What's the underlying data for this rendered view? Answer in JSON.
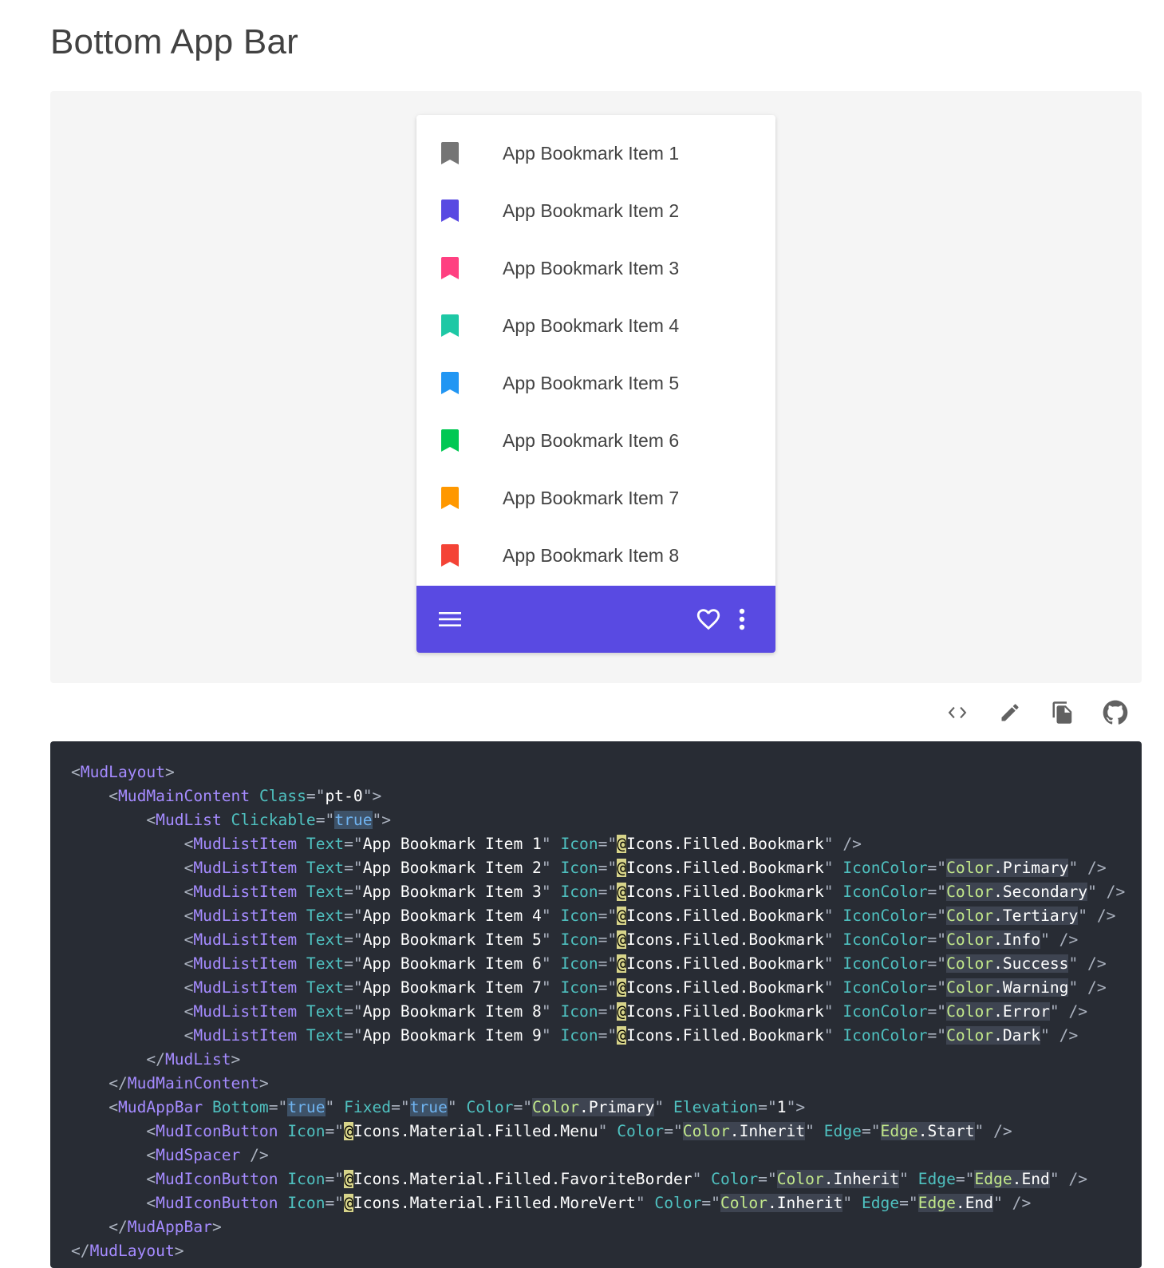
{
  "page": {
    "title": "Bottom App Bar"
  },
  "list": {
    "items": [
      {
        "text": "App Bookmark Item 1",
        "icon": "bookmark-icon",
        "color": "#757575"
      },
      {
        "text": "App Bookmark Item 2",
        "icon": "bookmark-icon",
        "color": "#594ae2"
      },
      {
        "text": "App Bookmark Item 3",
        "icon": "bookmark-icon",
        "color": "#ff4081"
      },
      {
        "text": "App Bookmark Item 4",
        "icon": "bookmark-icon",
        "color": "#1ec8a5"
      },
      {
        "text": "App Bookmark Item 5",
        "icon": "bookmark-icon",
        "color": "#2196f3"
      },
      {
        "text": "App Bookmark Item 6",
        "icon": "bookmark-icon",
        "color": "#00c853"
      },
      {
        "text": "App Bookmark Item 7",
        "icon": "bookmark-icon",
        "color": "#ff9800"
      },
      {
        "text": "App Bookmark Item 8",
        "icon": "bookmark-icon",
        "color": "#f44336"
      }
    ]
  },
  "app_bar": {
    "color": "#594ae2",
    "left_icon": "menu-icon",
    "right_icons": [
      "favorite-border-icon",
      "more-vert-icon"
    ]
  },
  "toolbar": {
    "icons": [
      "code-icon",
      "edit-icon",
      "copy-icon",
      "github-icon"
    ]
  },
  "code": {
    "lines": [
      [
        [
          "punct",
          "<"
        ],
        [
          "tag",
          "MudLayout"
        ],
        [
          "punct",
          ">"
        ]
      ],
      [
        [
          "plain",
          "    "
        ],
        [
          "punct",
          "<"
        ],
        [
          "tag",
          "MudMainContent"
        ],
        [
          "plain",
          " "
        ],
        [
          "attr",
          "Class"
        ],
        [
          "punct",
          "=\""
        ],
        [
          "str",
          "pt-0"
        ],
        [
          "punct",
          "\">"
        ]
      ],
      [
        [
          "plain",
          "        "
        ],
        [
          "punct",
          "<"
        ],
        [
          "tag",
          "MudList"
        ],
        [
          "plain",
          " "
        ],
        [
          "attr",
          "Clickable"
        ],
        [
          "punct",
          "=\""
        ],
        [
          "hl-bool",
          "true"
        ],
        [
          "punct",
          "\">"
        ]
      ],
      [
        [
          "plain",
          "            "
        ],
        [
          "punct",
          "<"
        ],
        [
          "tag",
          "MudListItem"
        ],
        [
          "plain",
          " "
        ],
        [
          "attr",
          "Text"
        ],
        [
          "punct",
          "=\""
        ],
        [
          "str",
          "App Bookmark Item 1"
        ],
        [
          "punct",
          "\""
        ],
        [
          "plain",
          " "
        ],
        [
          "attr",
          "Icon"
        ],
        [
          "punct",
          "=\""
        ],
        [
          "hl-at",
          "@"
        ],
        [
          "str",
          "Icons.Filled.Bookmark"
        ],
        [
          "punct",
          "\" />"
        ]
      ],
      [
        [
          "plain",
          "            "
        ],
        [
          "punct",
          "<"
        ],
        [
          "tag",
          "MudListItem"
        ],
        [
          "plain",
          " "
        ],
        [
          "attr",
          "Text"
        ],
        [
          "punct",
          "=\""
        ],
        [
          "str",
          "App Bookmark Item 2"
        ],
        [
          "punct",
          "\""
        ],
        [
          "plain",
          " "
        ],
        [
          "attr",
          "Icon"
        ],
        [
          "punct",
          "=\""
        ],
        [
          "hl-at",
          "@"
        ],
        [
          "str",
          "Icons.Filled.Bookmark"
        ],
        [
          "punct",
          "\""
        ],
        [
          "plain",
          " "
        ],
        [
          "attr",
          "IconColor"
        ],
        [
          "punct",
          "=\""
        ],
        [
          "hl-color",
          "Color"
        ],
        [
          "hl",
          "."
        ],
        [
          "hl",
          "Primary"
        ],
        [
          "punct",
          "\" />"
        ]
      ],
      [
        [
          "plain",
          "            "
        ],
        [
          "punct",
          "<"
        ],
        [
          "tag",
          "MudListItem"
        ],
        [
          "plain",
          " "
        ],
        [
          "attr",
          "Text"
        ],
        [
          "punct",
          "=\""
        ],
        [
          "str",
          "App Bookmark Item 3"
        ],
        [
          "punct",
          "\""
        ],
        [
          "plain",
          " "
        ],
        [
          "attr",
          "Icon"
        ],
        [
          "punct",
          "=\""
        ],
        [
          "hl-at",
          "@"
        ],
        [
          "str",
          "Icons.Filled.Bookmark"
        ],
        [
          "punct",
          "\""
        ],
        [
          "plain",
          " "
        ],
        [
          "attr",
          "IconColor"
        ],
        [
          "punct",
          "=\""
        ],
        [
          "hl-color",
          "Color"
        ],
        [
          "hl",
          "."
        ],
        [
          "hl",
          "Secondary"
        ],
        [
          "punct",
          "\" />"
        ]
      ],
      [
        [
          "plain",
          "            "
        ],
        [
          "punct",
          "<"
        ],
        [
          "tag",
          "MudListItem"
        ],
        [
          "plain",
          " "
        ],
        [
          "attr",
          "Text"
        ],
        [
          "punct",
          "=\""
        ],
        [
          "str",
          "App Bookmark Item 4"
        ],
        [
          "punct",
          "\""
        ],
        [
          "plain",
          " "
        ],
        [
          "attr",
          "Icon"
        ],
        [
          "punct",
          "=\""
        ],
        [
          "hl-at",
          "@"
        ],
        [
          "str",
          "Icons.Filled.Bookmark"
        ],
        [
          "punct",
          "\""
        ],
        [
          "plain",
          " "
        ],
        [
          "attr",
          "IconColor"
        ],
        [
          "punct",
          "=\""
        ],
        [
          "hl-color",
          "Color"
        ],
        [
          "hl",
          "."
        ],
        [
          "hl",
          "Tertiary"
        ],
        [
          "punct",
          "\" />"
        ]
      ],
      [
        [
          "plain",
          "            "
        ],
        [
          "punct",
          "<"
        ],
        [
          "tag",
          "MudListItem"
        ],
        [
          "plain",
          " "
        ],
        [
          "attr",
          "Text"
        ],
        [
          "punct",
          "=\""
        ],
        [
          "str",
          "App Bookmark Item 5"
        ],
        [
          "punct",
          "\""
        ],
        [
          "plain",
          " "
        ],
        [
          "attr",
          "Icon"
        ],
        [
          "punct",
          "=\""
        ],
        [
          "hl-at",
          "@"
        ],
        [
          "str",
          "Icons.Filled.Bookmark"
        ],
        [
          "punct",
          "\""
        ],
        [
          "plain",
          " "
        ],
        [
          "attr",
          "IconColor"
        ],
        [
          "punct",
          "=\""
        ],
        [
          "hl-color",
          "Color"
        ],
        [
          "hl",
          "."
        ],
        [
          "hl",
          "Info"
        ],
        [
          "punct",
          "\" />"
        ]
      ],
      [
        [
          "plain",
          "            "
        ],
        [
          "punct",
          "<"
        ],
        [
          "tag",
          "MudListItem"
        ],
        [
          "plain",
          " "
        ],
        [
          "attr",
          "Text"
        ],
        [
          "punct",
          "=\""
        ],
        [
          "str",
          "App Bookmark Item 6"
        ],
        [
          "punct",
          "\""
        ],
        [
          "plain",
          " "
        ],
        [
          "attr",
          "Icon"
        ],
        [
          "punct",
          "=\""
        ],
        [
          "hl-at",
          "@"
        ],
        [
          "str",
          "Icons.Filled.Bookmark"
        ],
        [
          "punct",
          "\""
        ],
        [
          "plain",
          " "
        ],
        [
          "attr",
          "IconColor"
        ],
        [
          "punct",
          "=\""
        ],
        [
          "hl-color",
          "Color"
        ],
        [
          "hl",
          "."
        ],
        [
          "hl",
          "Success"
        ],
        [
          "punct",
          "\" />"
        ]
      ],
      [
        [
          "plain",
          "            "
        ],
        [
          "punct",
          "<"
        ],
        [
          "tag",
          "MudListItem"
        ],
        [
          "plain",
          " "
        ],
        [
          "attr",
          "Text"
        ],
        [
          "punct",
          "=\""
        ],
        [
          "str",
          "App Bookmark Item 7"
        ],
        [
          "punct",
          "\""
        ],
        [
          "plain",
          " "
        ],
        [
          "attr",
          "Icon"
        ],
        [
          "punct",
          "=\""
        ],
        [
          "hl-at",
          "@"
        ],
        [
          "str",
          "Icons.Filled.Bookmark"
        ],
        [
          "punct",
          "\""
        ],
        [
          "plain",
          " "
        ],
        [
          "attr",
          "IconColor"
        ],
        [
          "punct",
          "=\""
        ],
        [
          "hl-color",
          "Color"
        ],
        [
          "hl",
          "."
        ],
        [
          "hl",
          "Warning"
        ],
        [
          "punct",
          "\" />"
        ]
      ],
      [
        [
          "plain",
          "            "
        ],
        [
          "punct",
          "<"
        ],
        [
          "tag",
          "MudListItem"
        ],
        [
          "plain",
          " "
        ],
        [
          "attr",
          "Text"
        ],
        [
          "punct",
          "=\""
        ],
        [
          "str",
          "App Bookmark Item 8"
        ],
        [
          "punct",
          "\""
        ],
        [
          "plain",
          " "
        ],
        [
          "attr",
          "Icon"
        ],
        [
          "punct",
          "=\""
        ],
        [
          "hl-at",
          "@"
        ],
        [
          "str",
          "Icons.Filled.Bookmark"
        ],
        [
          "punct",
          "\""
        ],
        [
          "plain",
          " "
        ],
        [
          "attr",
          "IconColor"
        ],
        [
          "punct",
          "=\""
        ],
        [
          "hl-color",
          "Color"
        ],
        [
          "hl",
          "."
        ],
        [
          "hl",
          "Error"
        ],
        [
          "punct",
          "\" />"
        ]
      ],
      [
        [
          "plain",
          "            "
        ],
        [
          "punct",
          "<"
        ],
        [
          "tag",
          "MudListItem"
        ],
        [
          "plain",
          " "
        ],
        [
          "attr",
          "Text"
        ],
        [
          "punct",
          "=\""
        ],
        [
          "str",
          "App Bookmark Item 9"
        ],
        [
          "punct",
          "\""
        ],
        [
          "plain",
          " "
        ],
        [
          "attr",
          "Icon"
        ],
        [
          "punct",
          "=\""
        ],
        [
          "hl-at",
          "@"
        ],
        [
          "str",
          "Icons.Filled.Bookmark"
        ],
        [
          "punct",
          "\""
        ],
        [
          "plain",
          " "
        ],
        [
          "attr",
          "IconColor"
        ],
        [
          "punct",
          "=\""
        ],
        [
          "hl-color",
          "Color"
        ],
        [
          "hl",
          "."
        ],
        [
          "hl",
          "Dark"
        ],
        [
          "punct",
          "\" />"
        ]
      ],
      [
        [
          "plain",
          "        "
        ],
        [
          "punct",
          "</"
        ],
        [
          "tag",
          "MudList"
        ],
        [
          "punct",
          ">"
        ]
      ],
      [
        [
          "plain",
          "    "
        ],
        [
          "punct",
          "</"
        ],
        [
          "tag",
          "MudMainContent"
        ],
        [
          "punct",
          ">"
        ]
      ],
      [
        [
          "plain",
          "    "
        ],
        [
          "punct",
          "<"
        ],
        [
          "tag",
          "MudAppBar"
        ],
        [
          "plain",
          " "
        ],
        [
          "attr",
          "Bottom"
        ],
        [
          "punct",
          "=\""
        ],
        [
          "hl-bool",
          "true"
        ],
        [
          "punct",
          "\""
        ],
        [
          "plain",
          " "
        ],
        [
          "attr",
          "Fixed"
        ],
        [
          "punct",
          "=\""
        ],
        [
          "hl-bool",
          "true"
        ],
        [
          "punct",
          "\""
        ],
        [
          "plain",
          " "
        ],
        [
          "attr",
          "Color"
        ],
        [
          "punct",
          "=\""
        ],
        [
          "hl-color",
          "Color"
        ],
        [
          "hl",
          "."
        ],
        [
          "hl",
          "Primary"
        ],
        [
          "punct",
          "\""
        ],
        [
          "plain",
          " "
        ],
        [
          "attr",
          "Elevation"
        ],
        [
          "punct",
          "=\""
        ],
        [
          "str",
          "1"
        ],
        [
          "punct",
          "\">"
        ]
      ],
      [
        [
          "plain",
          "        "
        ],
        [
          "punct",
          "<"
        ],
        [
          "tag",
          "MudIconButton"
        ],
        [
          "plain",
          " "
        ],
        [
          "attr",
          "Icon"
        ],
        [
          "punct",
          "=\""
        ],
        [
          "hl-at",
          "@"
        ],
        [
          "str",
          "Icons.Material.Filled.Menu"
        ],
        [
          "punct",
          "\""
        ],
        [
          "plain",
          " "
        ],
        [
          "attr",
          "Color"
        ],
        [
          "punct",
          "=\""
        ],
        [
          "hl-color",
          "Color"
        ],
        [
          "hl",
          "."
        ],
        [
          "hl",
          "Inherit"
        ],
        [
          "punct",
          "\""
        ],
        [
          "plain",
          " "
        ],
        [
          "attr",
          "Edge"
        ],
        [
          "punct",
          "=\""
        ],
        [
          "hl-color",
          "Edge"
        ],
        [
          "hl",
          "."
        ],
        [
          "hl",
          "Start"
        ],
        [
          "punct",
          "\" />"
        ]
      ],
      [
        [
          "plain",
          "        "
        ],
        [
          "punct",
          "<"
        ],
        [
          "tag",
          "MudSpacer"
        ],
        [
          "plain",
          " "
        ],
        [
          "punct",
          "/>"
        ]
      ],
      [
        [
          "plain",
          "        "
        ],
        [
          "punct",
          "<"
        ],
        [
          "tag",
          "MudIconButton"
        ],
        [
          "plain",
          " "
        ],
        [
          "attr",
          "Icon"
        ],
        [
          "punct",
          "=\""
        ],
        [
          "hl-at",
          "@"
        ],
        [
          "str",
          "Icons.Material.Filled.FavoriteBorder"
        ],
        [
          "punct",
          "\""
        ],
        [
          "plain",
          " "
        ],
        [
          "attr",
          "Color"
        ],
        [
          "punct",
          "=\""
        ],
        [
          "hl-color",
          "Color"
        ],
        [
          "hl",
          "."
        ],
        [
          "hl",
          "Inherit"
        ],
        [
          "punct",
          "\""
        ],
        [
          "plain",
          " "
        ],
        [
          "attr",
          "Edge"
        ],
        [
          "punct",
          "=\""
        ],
        [
          "hl-color",
          "Edge"
        ],
        [
          "hl",
          "."
        ],
        [
          "hl",
          "End"
        ],
        [
          "punct",
          "\" />"
        ]
      ],
      [
        [
          "plain",
          "        "
        ],
        [
          "punct",
          "<"
        ],
        [
          "tag",
          "MudIconButton"
        ],
        [
          "plain",
          " "
        ],
        [
          "attr",
          "Icon"
        ],
        [
          "punct",
          "=\""
        ],
        [
          "hl-at",
          "@"
        ],
        [
          "str",
          "Icons.Material.Filled.MoreVert"
        ],
        [
          "punct",
          "\""
        ],
        [
          "plain",
          " "
        ],
        [
          "attr",
          "Color"
        ],
        [
          "punct",
          "=\""
        ],
        [
          "hl-color",
          "Color"
        ],
        [
          "hl",
          "."
        ],
        [
          "hl",
          "Inherit"
        ],
        [
          "punct",
          "\""
        ],
        [
          "plain",
          " "
        ],
        [
          "attr",
          "Edge"
        ],
        [
          "punct",
          "=\""
        ],
        [
          "hl-color",
          "Edge"
        ],
        [
          "hl",
          "."
        ],
        [
          "hl",
          "End"
        ],
        [
          "punct",
          "\" />"
        ]
      ],
      [
        [
          "plain",
          "    "
        ],
        [
          "punct",
          "</"
        ],
        [
          "tag",
          "MudAppBar"
        ],
        [
          "punct",
          ">"
        ]
      ],
      [
        [
          "punct",
          "</"
        ],
        [
          "tag",
          "MudLayout"
        ],
        [
          "punct",
          ">"
        ]
      ]
    ]
  }
}
